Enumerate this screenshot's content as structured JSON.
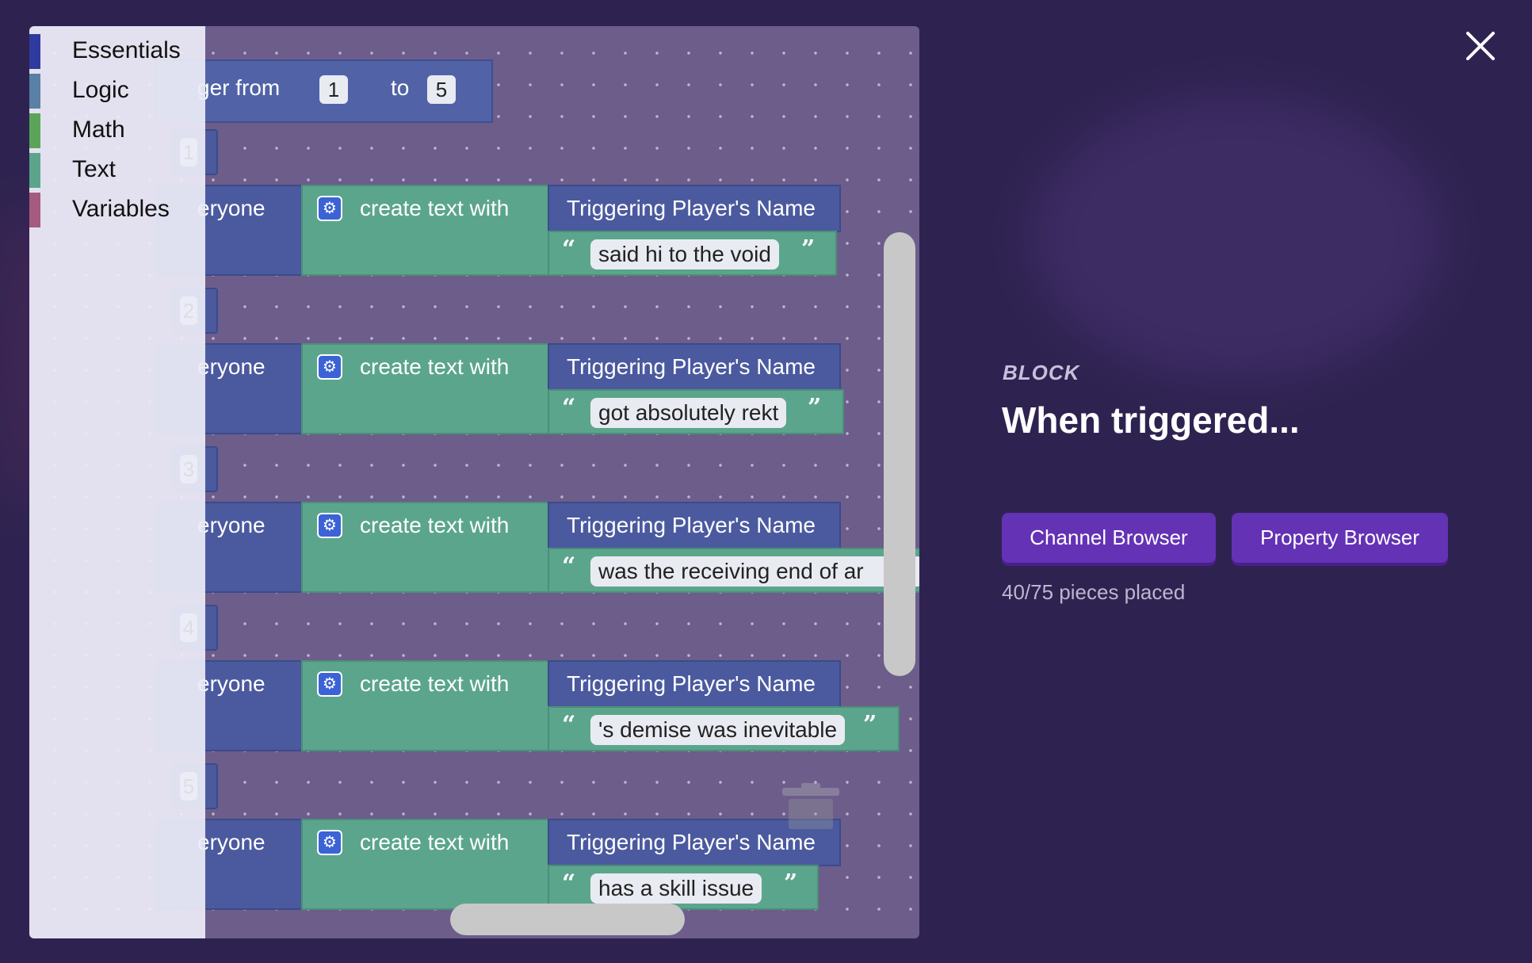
{
  "toolbox": {
    "categories": [
      {
        "label": "Essentials",
        "color": "#2f3aa0"
      },
      {
        "label": "Logic",
        "color": "#5b80a5"
      },
      {
        "label": "Math",
        "color": "#5ba55b"
      },
      {
        "label": "Text",
        "color": "#5ba58c"
      },
      {
        "label": "Variables",
        "color": "#a55b80"
      }
    ]
  },
  "workspace": {
    "loop": {
      "label": "ger from",
      "from": "1",
      "to_label": "to",
      "to": "5"
    },
    "case_numbers": [
      "1",
      "2",
      "3",
      "4",
      "5"
    ],
    "action_label": "eryone",
    "create_text_label": "create text with",
    "player_name_label": "Triggering Player's Name",
    "messages": [
      "said hi to the void",
      "got absolutely rekt",
      "was the receiving end of ar",
      "'s demise was inevitable",
      "has a skill issue"
    ],
    "open_quote": "“",
    "close_quote": "”"
  },
  "side_panel": {
    "label": "BLOCK",
    "title": "When triggered...",
    "channel_button": "Channel Browser",
    "property_button": "Property Browser",
    "pieces_placed": "40/75 pieces placed"
  }
}
